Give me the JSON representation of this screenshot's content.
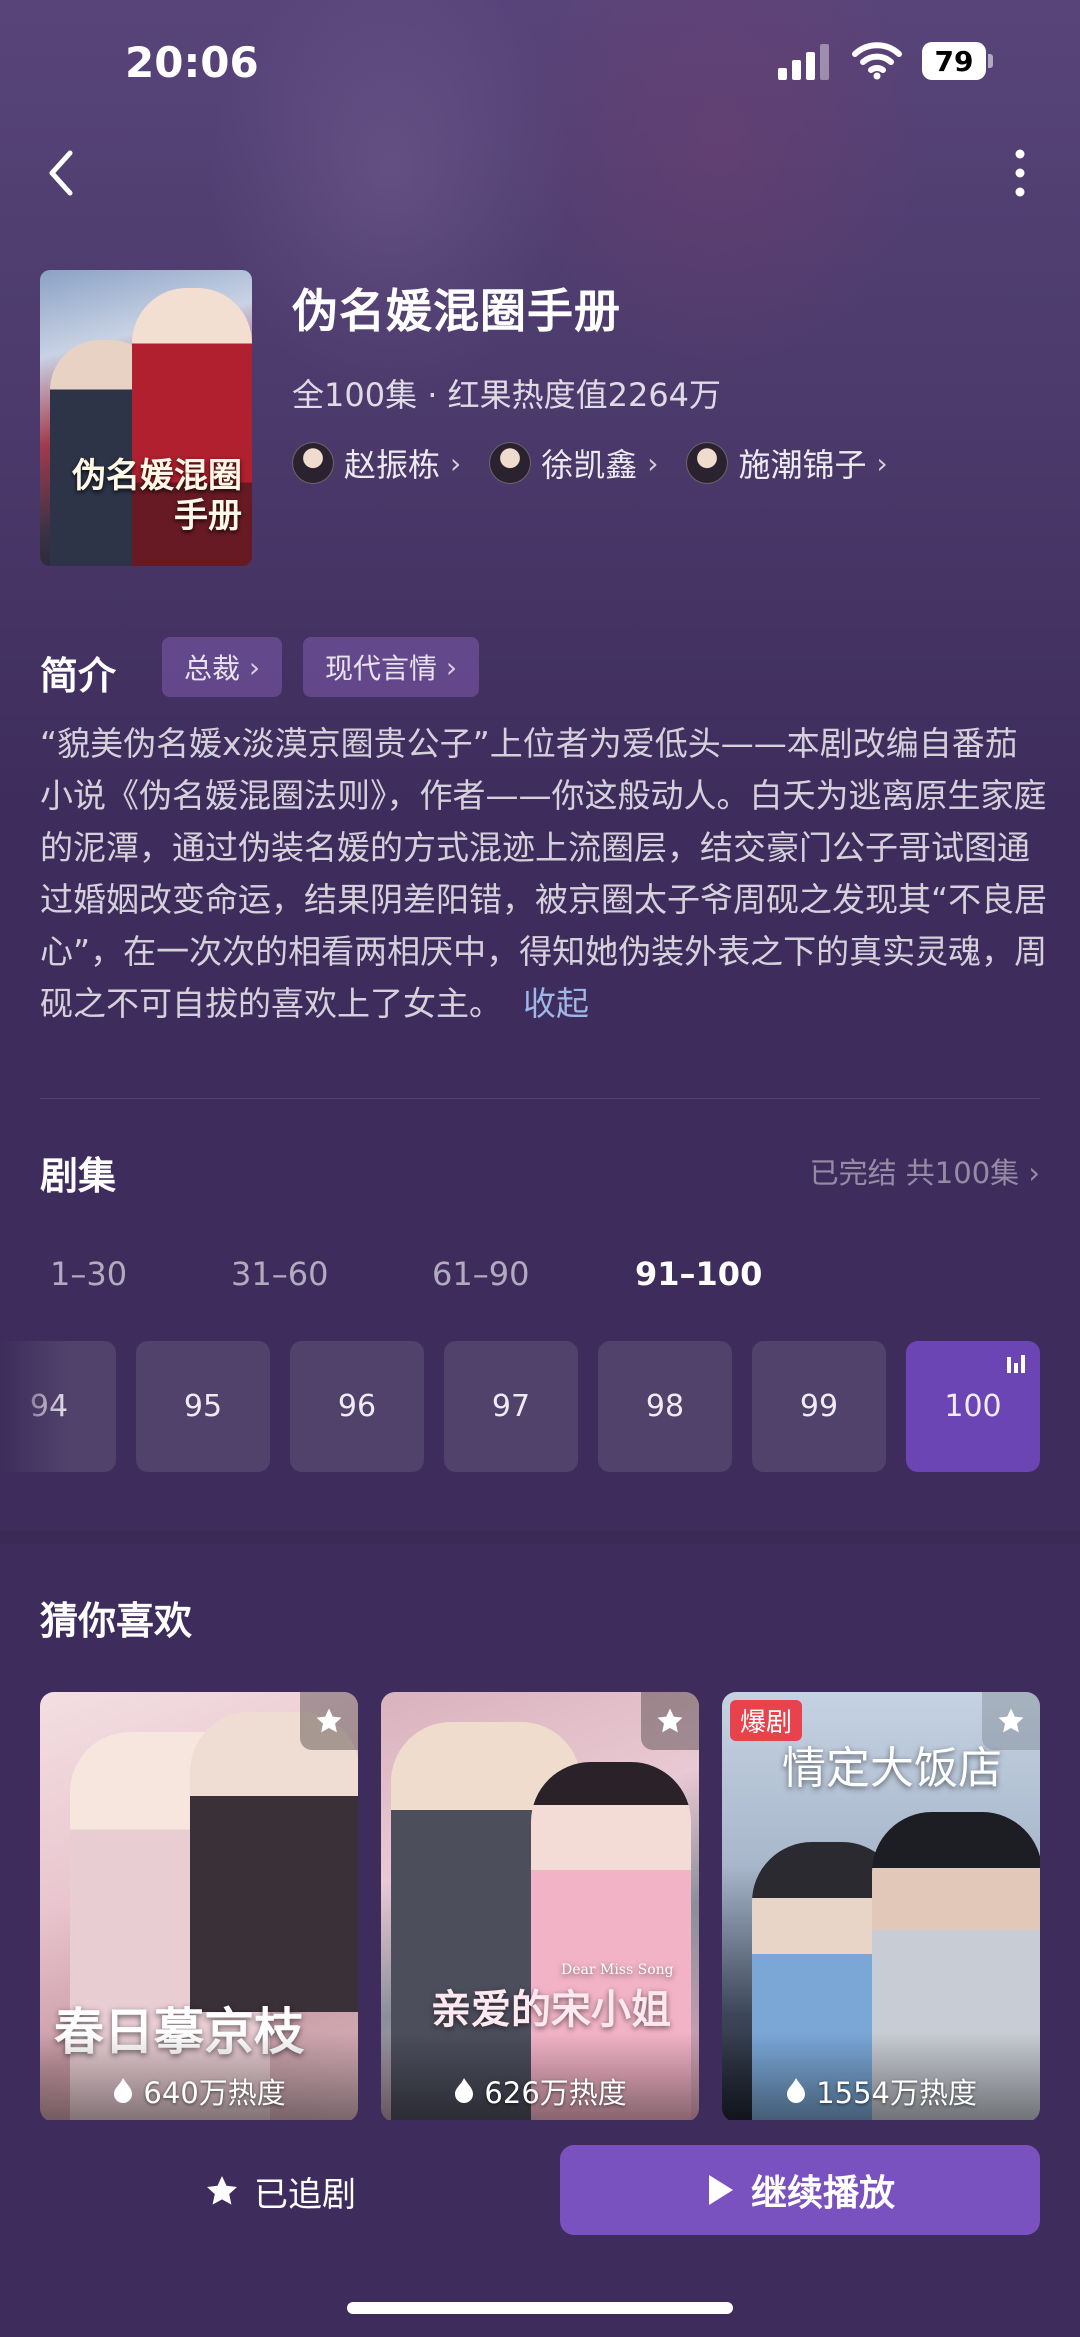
{
  "status_bar": {
    "time": "20:06",
    "battery": "79"
  },
  "drama": {
    "title": "伪名媛混圈手册",
    "poster_title": "伪名媛混圈手册",
    "meta": "全100集 · 红果热度值2264万",
    "actors": [
      {
        "name": "赵振栋"
      },
      {
        "name": "徐凯鑫"
      },
      {
        "name": "施潮锦子"
      }
    ]
  },
  "intro": {
    "label": "简介",
    "tags": [
      "总裁",
      "现代言情"
    ],
    "text": "“貌美伪名媛x淡漠京圈贵公子”上位者为爱低头——本剧改编自番茄小说《伪名媛混圈法则》，作者——你这般动人。白夭为逃离原生家庭的泥潭，通过伪装名媛的方式混迹上流圈层，结交豪门公子哥试图通过婚姻改变命运，结果阴差阳错，被京圈太子爷周砚之发现其“不良居心”，在一次次的相看两相厌中，得知她伪装外表之下的真实灵魂，周砚之不可自拔的喜欢上了女主。",
    "collapse_label": "收起"
  },
  "episodes": {
    "label": "剧集",
    "status": "已完结 共100集",
    "ranges": [
      "1–30",
      "31–60",
      "61–90",
      "91–100"
    ],
    "active_range": "91–100",
    "items": [
      "94",
      "95",
      "96",
      "97",
      "98",
      "99",
      "100"
    ],
    "current": "100"
  },
  "recommend": {
    "label": "猜你喜欢",
    "cards": [
      {
        "title": "春日摹京枝",
        "heat": "640万热度"
      },
      {
        "title": "亲爱的宋小姐",
        "subtitle": "Dear Miss Song",
        "heat": "626万热度"
      },
      {
        "title": "情定大饭店",
        "badge": "爆剧",
        "heat": "1554万热度"
      }
    ]
  },
  "bottom": {
    "follow_label": "已追剧",
    "play_label": "继续播放"
  },
  "colors": {
    "background": "#3e2d5c",
    "accent": "#7a52c0",
    "link": "#9fb6e8"
  },
  "icons": [
    "back-icon",
    "more-icon",
    "signal-icon",
    "wifi-icon",
    "battery-icon",
    "star-icon",
    "play-icon",
    "playing-indicator-icon",
    "flame-icon"
  ]
}
